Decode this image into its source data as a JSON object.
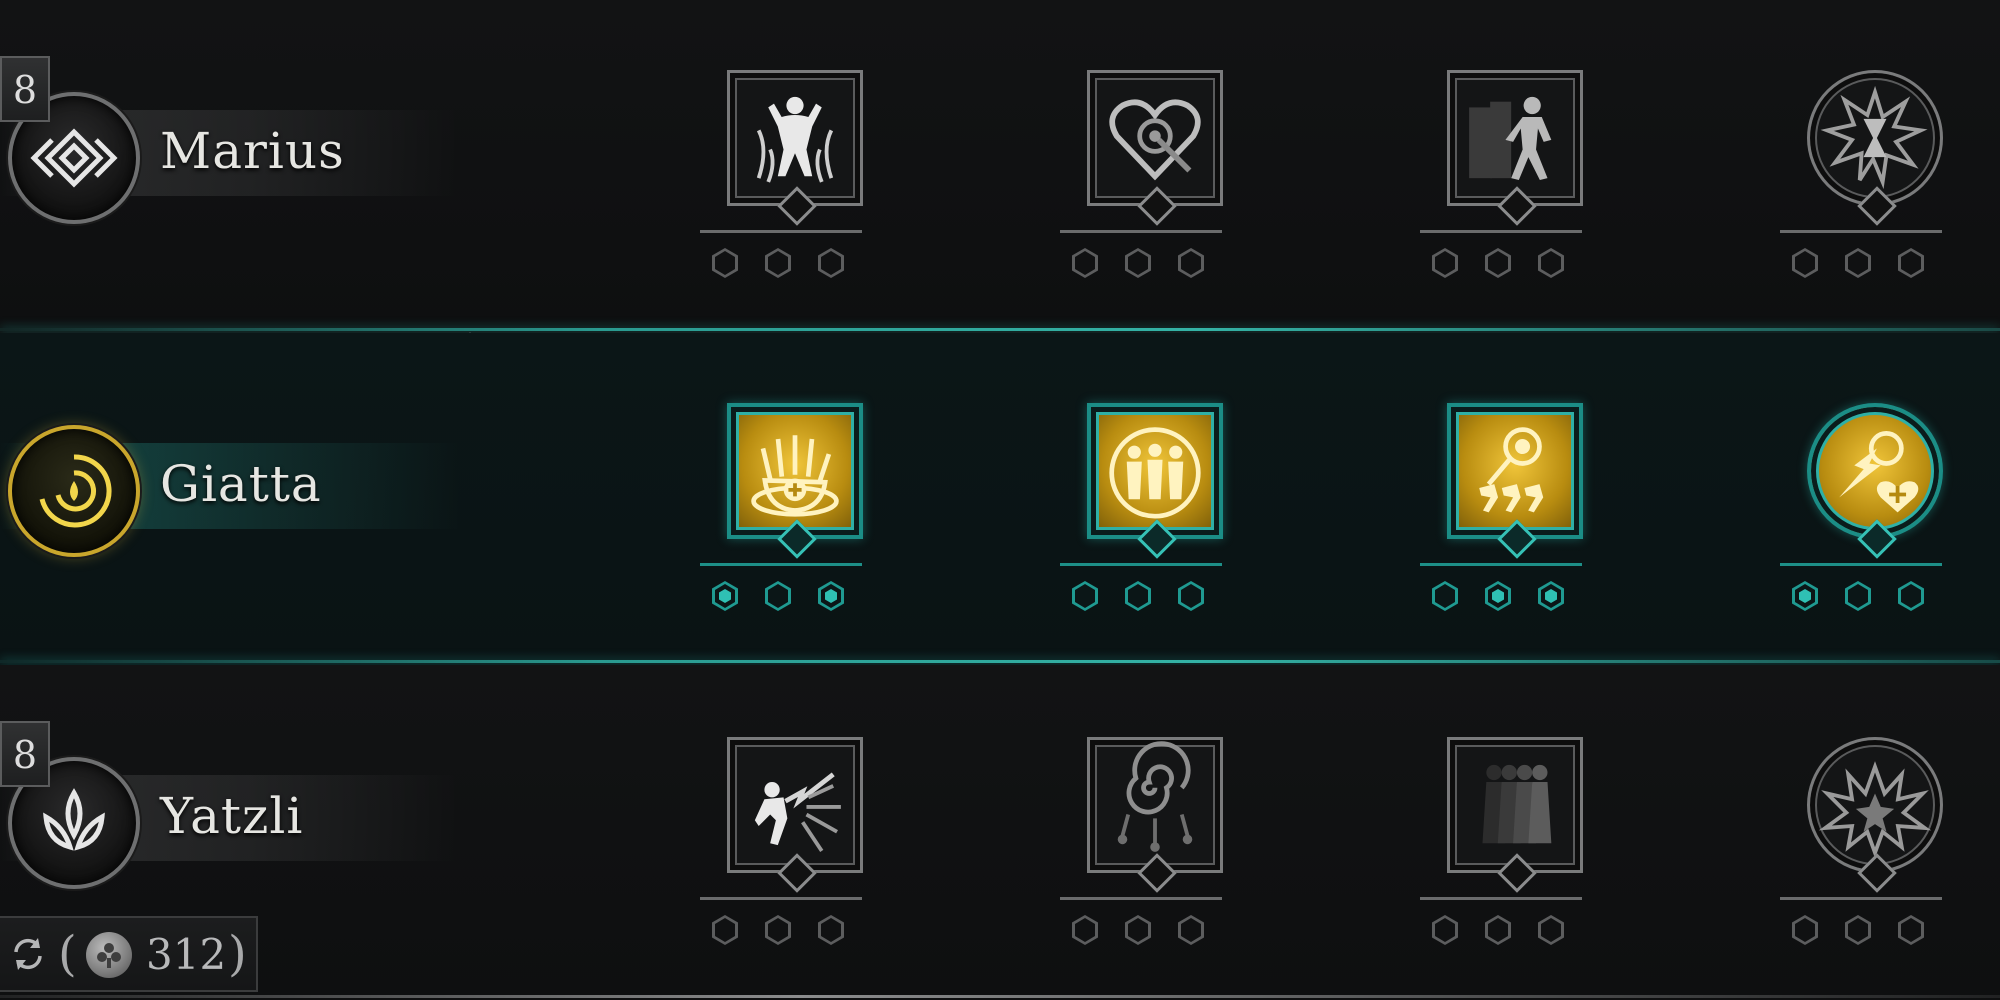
{
  "characters": [
    {
      "name": "Marius",
      "level": "8",
      "emblem": "diamond-knot-emblem-icon",
      "selected": false,
      "perks": [
        {
          "icon": "mind-control-figure-icon",
          "shape": "square",
          "active": false,
          "upgrades": [
            false,
            false,
            false
          ]
        },
        {
          "icon": "targeted-heart-icon",
          "shape": "square",
          "active": false,
          "upgrades": [
            false,
            false,
            false
          ]
        },
        {
          "icon": "dash-afterimage-icon",
          "shape": "square",
          "active": false,
          "upgrades": [
            false,
            false,
            false
          ]
        },
        {
          "icon": "hourglass-burst-icon",
          "shape": "round",
          "active": false,
          "upgrades": [
            false,
            false,
            false
          ]
        }
      ]
    },
    {
      "name": "Giatta",
      "level": "",
      "emblem": "water-drop-spiral-emblem-icon",
      "selected": true,
      "perks": [
        {
          "icon": "healing-hand-icon",
          "shape": "square",
          "active": true,
          "upgrades": [
            true,
            false,
            true
          ]
        },
        {
          "icon": "three-allies-icon",
          "shape": "square",
          "active": true,
          "upgrades": [
            false,
            false,
            false
          ]
        },
        {
          "icon": "sun-runners-icon",
          "shape": "square",
          "active": true,
          "upgrades": [
            false,
            true,
            true
          ]
        },
        {
          "icon": "burst-heal-icon",
          "shape": "round",
          "active": true,
          "upgrades": [
            true,
            false,
            false
          ]
        }
      ]
    },
    {
      "name": "Yatzli",
      "level": "8",
      "emblem": "lotus-emblem-icon",
      "selected": false,
      "perks": [
        {
          "icon": "lightning-strike-figure-icon",
          "shape": "square",
          "active": false,
          "upgrades": [
            false,
            false,
            false
          ]
        },
        {
          "icon": "spiral-charm-icon",
          "shape": "square",
          "active": false,
          "upgrades": [
            false,
            false,
            false
          ]
        },
        {
          "icon": "shadow-clones-icon",
          "shape": "square",
          "active": false,
          "upgrades": [
            false,
            false,
            false
          ]
        },
        {
          "icon": "explosion-burst-icon",
          "shape": "round",
          "active": false,
          "upgrades": [
            false,
            false,
            false
          ]
        }
      ]
    }
  ],
  "footer": {
    "reset_icon": "reset-cycle-icon",
    "currency_icon": "silver-coin-icon",
    "open_paren": "(",
    "amount": "312",
    "close_paren": ")"
  },
  "colors": {
    "accent_teal": "#2fb0a6",
    "gold": "#d8ae2a",
    "inactive_gray": "#7a7b7c",
    "background": "#0f1011"
  }
}
